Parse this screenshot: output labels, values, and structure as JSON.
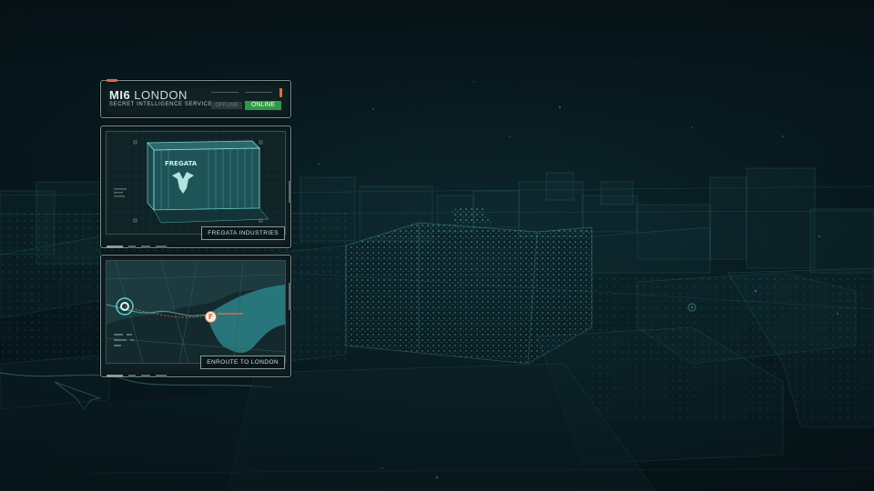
{
  "header": {
    "agency": "MI6",
    "city": "LONDON",
    "subtitle": "SECRET INTELLIGENCE SERVICE",
    "status_offline": "OFFLINE",
    "status_online": "ONLINE"
  },
  "cargo": {
    "logo_text": "FREGATA",
    "caption": "FREGATA INDUSTRIES"
  },
  "map": {
    "marker_letter": "F",
    "caption": "ENROUTE TO LONDON"
  },
  "colors": {
    "accent": "#d9703a",
    "online": "#2f9a45",
    "hologram": "#5fd3cf",
    "panel_border": "#7b8d8f"
  }
}
